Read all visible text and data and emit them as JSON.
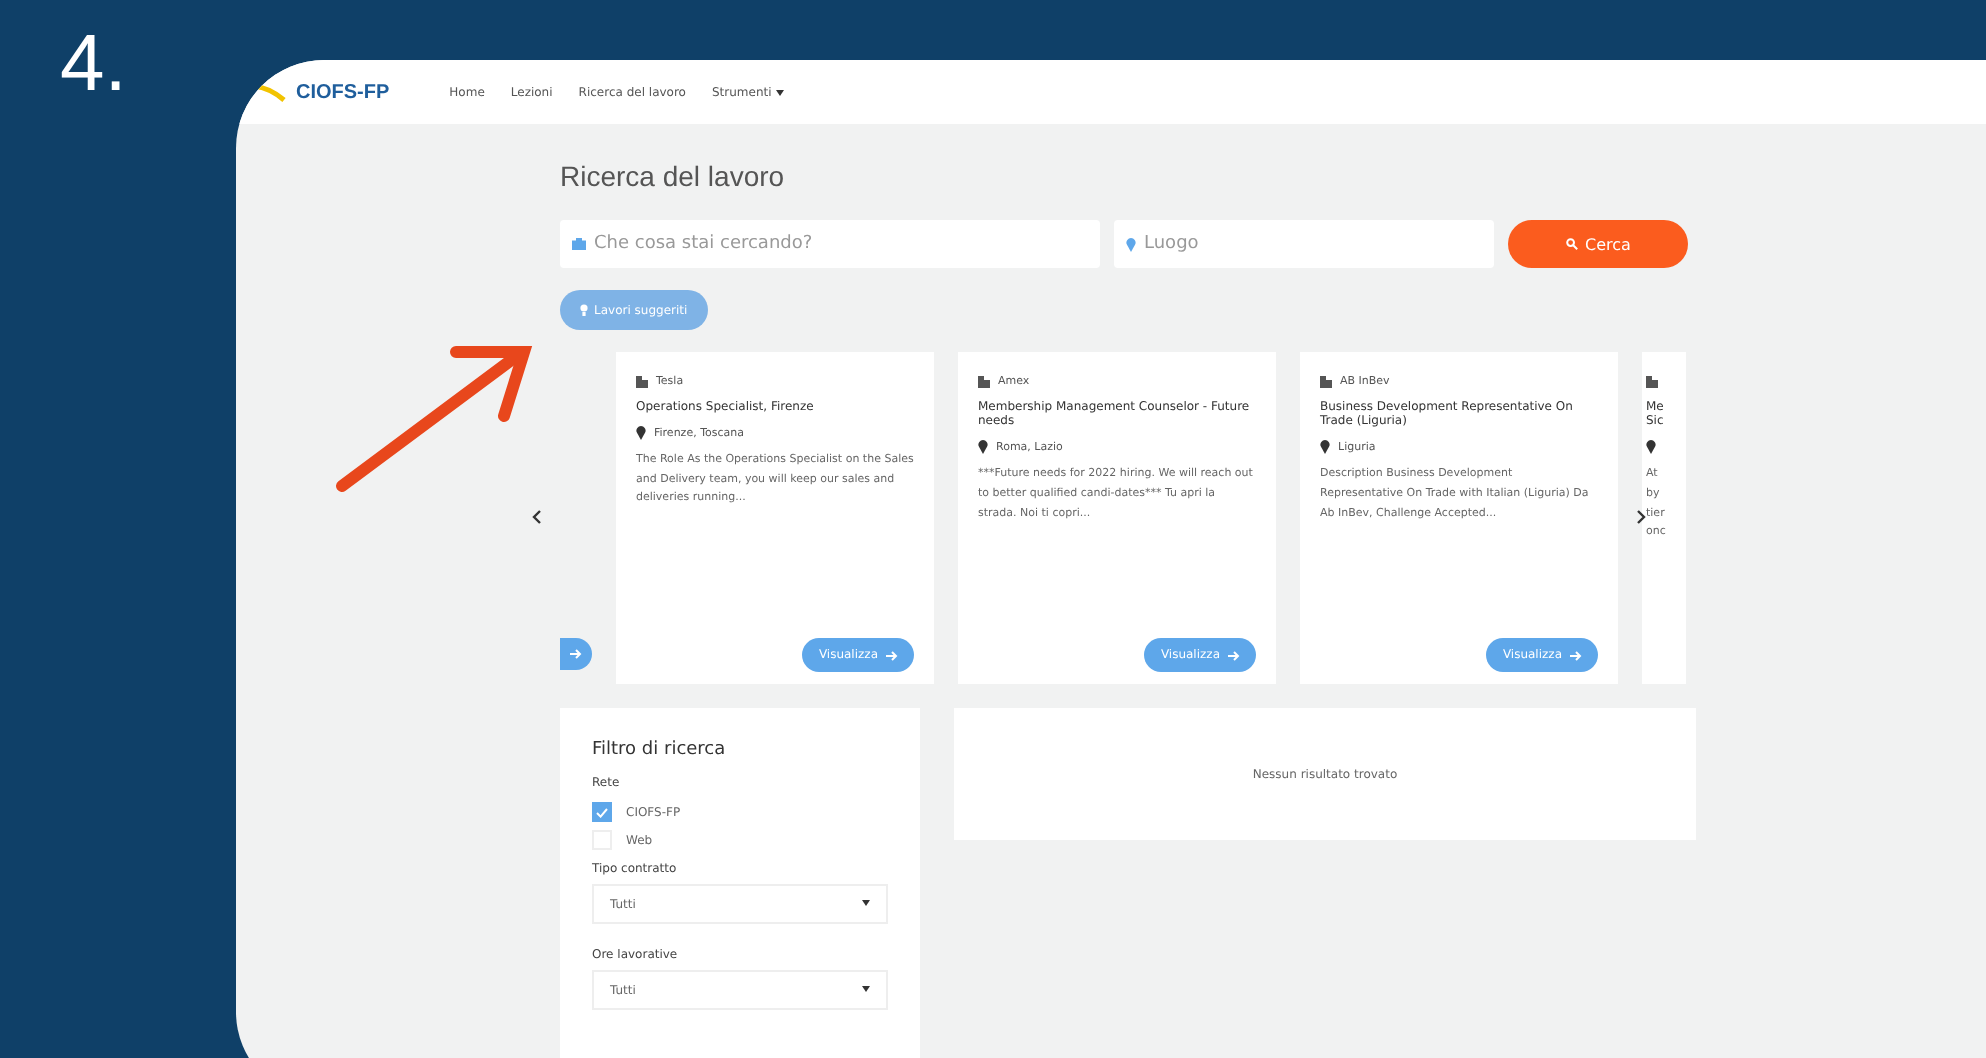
{
  "slide_number": "4.",
  "nav": {
    "logo": "CIOFS-FP",
    "items": [
      {
        "label": "Home",
        "dropdown": false
      },
      {
        "label": "Lezioni",
        "dropdown": false
      },
      {
        "label": "Ricerca del lavoro",
        "dropdown": false
      },
      {
        "label": "Strumenti",
        "dropdown": true
      }
    ]
  },
  "page_title": "Ricerca del lavoro",
  "search": {
    "what_placeholder": "Che cosa stai cercando?",
    "where_placeholder": "Luogo",
    "button": "Cerca"
  },
  "suggested_button": "Lavori suggeriti",
  "cards": [
    {
      "kind": "partial-left"
    },
    {
      "kind": "full",
      "company": "Tesla",
      "title": "Operations Specialist, Firenze",
      "location": "Firenze, Toscana",
      "description": "The Role As the Operations Specialist on the Sales and Delivery team, you will keep our sales and deliveries running...",
      "button": "Visualizza"
    },
    {
      "kind": "full",
      "company": "Amex",
      "title": "Membership Management Counselor - Future needs",
      "location": "Roma, Lazio",
      "description": "***Future needs for 2022 hiring. We will reach out to better qualified candi-dates*** Tu apri la strada. Noi ti copri...",
      "button": "Visualizza"
    },
    {
      "kind": "full",
      "company": "AB InBev",
      "title": "Business Development Representative On Trade (Liguria)",
      "location": "Liguria",
      "description": "Description Business Development Representative On Trade with Italian (Liguria) Da Ab InBev, Challenge Accepted...",
      "button": "Visualizza"
    },
    {
      "kind": "partial-right",
      "title_lines": [
        "Me",
        "Sic"
      ],
      "description_lines": [
        "At",
        "by",
        "tier",
        "onc"
      ]
    }
  ],
  "filter": {
    "title": "Filtro di ricerca",
    "network_label": "Rete",
    "options": [
      {
        "label": "CIOFS-FP",
        "checked": true
      },
      {
        "label": "Web",
        "checked": false
      }
    ],
    "selects": [
      {
        "label": "Tipo contratto",
        "value": "Tutti"
      },
      {
        "label": "Ore lavorative",
        "value": "Tutti"
      }
    ]
  },
  "results_message": "Nessun risultato trovato"
}
